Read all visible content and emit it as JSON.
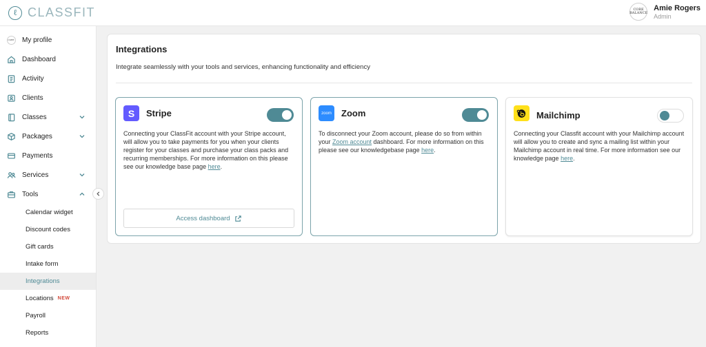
{
  "app": {
    "logo_text": "CLASSFIT"
  },
  "user": {
    "name": "Amie Rogers",
    "role": "Admin",
    "avatar_text": "CORE BALANCE"
  },
  "sidebar": {
    "items": [
      {
        "label": "My profile",
        "icon": "profile-avatar"
      },
      {
        "label": "Dashboard",
        "icon": "home-icon"
      },
      {
        "label": "Activity",
        "icon": "clipboard-icon"
      },
      {
        "label": "Clients",
        "icon": "clients-icon"
      },
      {
        "label": "Classes",
        "icon": "book-icon"
      },
      {
        "label": "Packages",
        "icon": "box-icon"
      },
      {
        "label": "Payments",
        "icon": "card-icon"
      },
      {
        "label": "Services",
        "icon": "services-icon"
      },
      {
        "label": "Tools",
        "icon": "briefcase-icon"
      }
    ],
    "tools_sub": [
      {
        "label": "Calendar widget"
      },
      {
        "label": "Discount codes"
      },
      {
        "label": "Gift cards"
      },
      {
        "label": "Intake form"
      },
      {
        "label": "Integrations"
      },
      {
        "label": "Locations",
        "badge": "NEW"
      },
      {
        "label": "Payroll"
      },
      {
        "label": "Reports"
      }
    ]
  },
  "page": {
    "title": "Integrations",
    "subtitle": "Integrate seamlessly with your tools and services, enhancing functionality and efficiency"
  },
  "integrations": {
    "stripe": {
      "name": "Stripe",
      "enabled": true,
      "description": "Connecting your ClassFit account with your Stripe account, will allow you to take payments for you when your clients register for your classes and purchase your class packs and recurring memberships. For more information on this please see our knowledge base page ",
      "link_text": "here",
      "suffix": ".",
      "button_label": "Access dashboard"
    },
    "zoom": {
      "name": "Zoom",
      "enabled": true,
      "icon_text": "zoom",
      "desc_part1": "To disconnect your Zoom account, please do so from within your ",
      "link1_text": "Zoom account",
      "desc_part2": " dashboard. For more information on this please see our knowledgebase page ",
      "link2_text": "here",
      "suffix": "."
    },
    "mailchimp": {
      "name": "Mailchimp",
      "enabled": false,
      "description": "Connecting your Classfit account with your Mailchimp account will allow you to create and sync a mailing list within your Mailchimp account in real time. For more information see our knowledge page ",
      "link_text": "here",
      "suffix": "."
    }
  },
  "colors": {
    "accent": "#4f8a95",
    "stripe": "#635bff",
    "zoom": "#2d8cff",
    "mailchimp": "#ffe01b",
    "new_badge": "#d34a3b"
  }
}
